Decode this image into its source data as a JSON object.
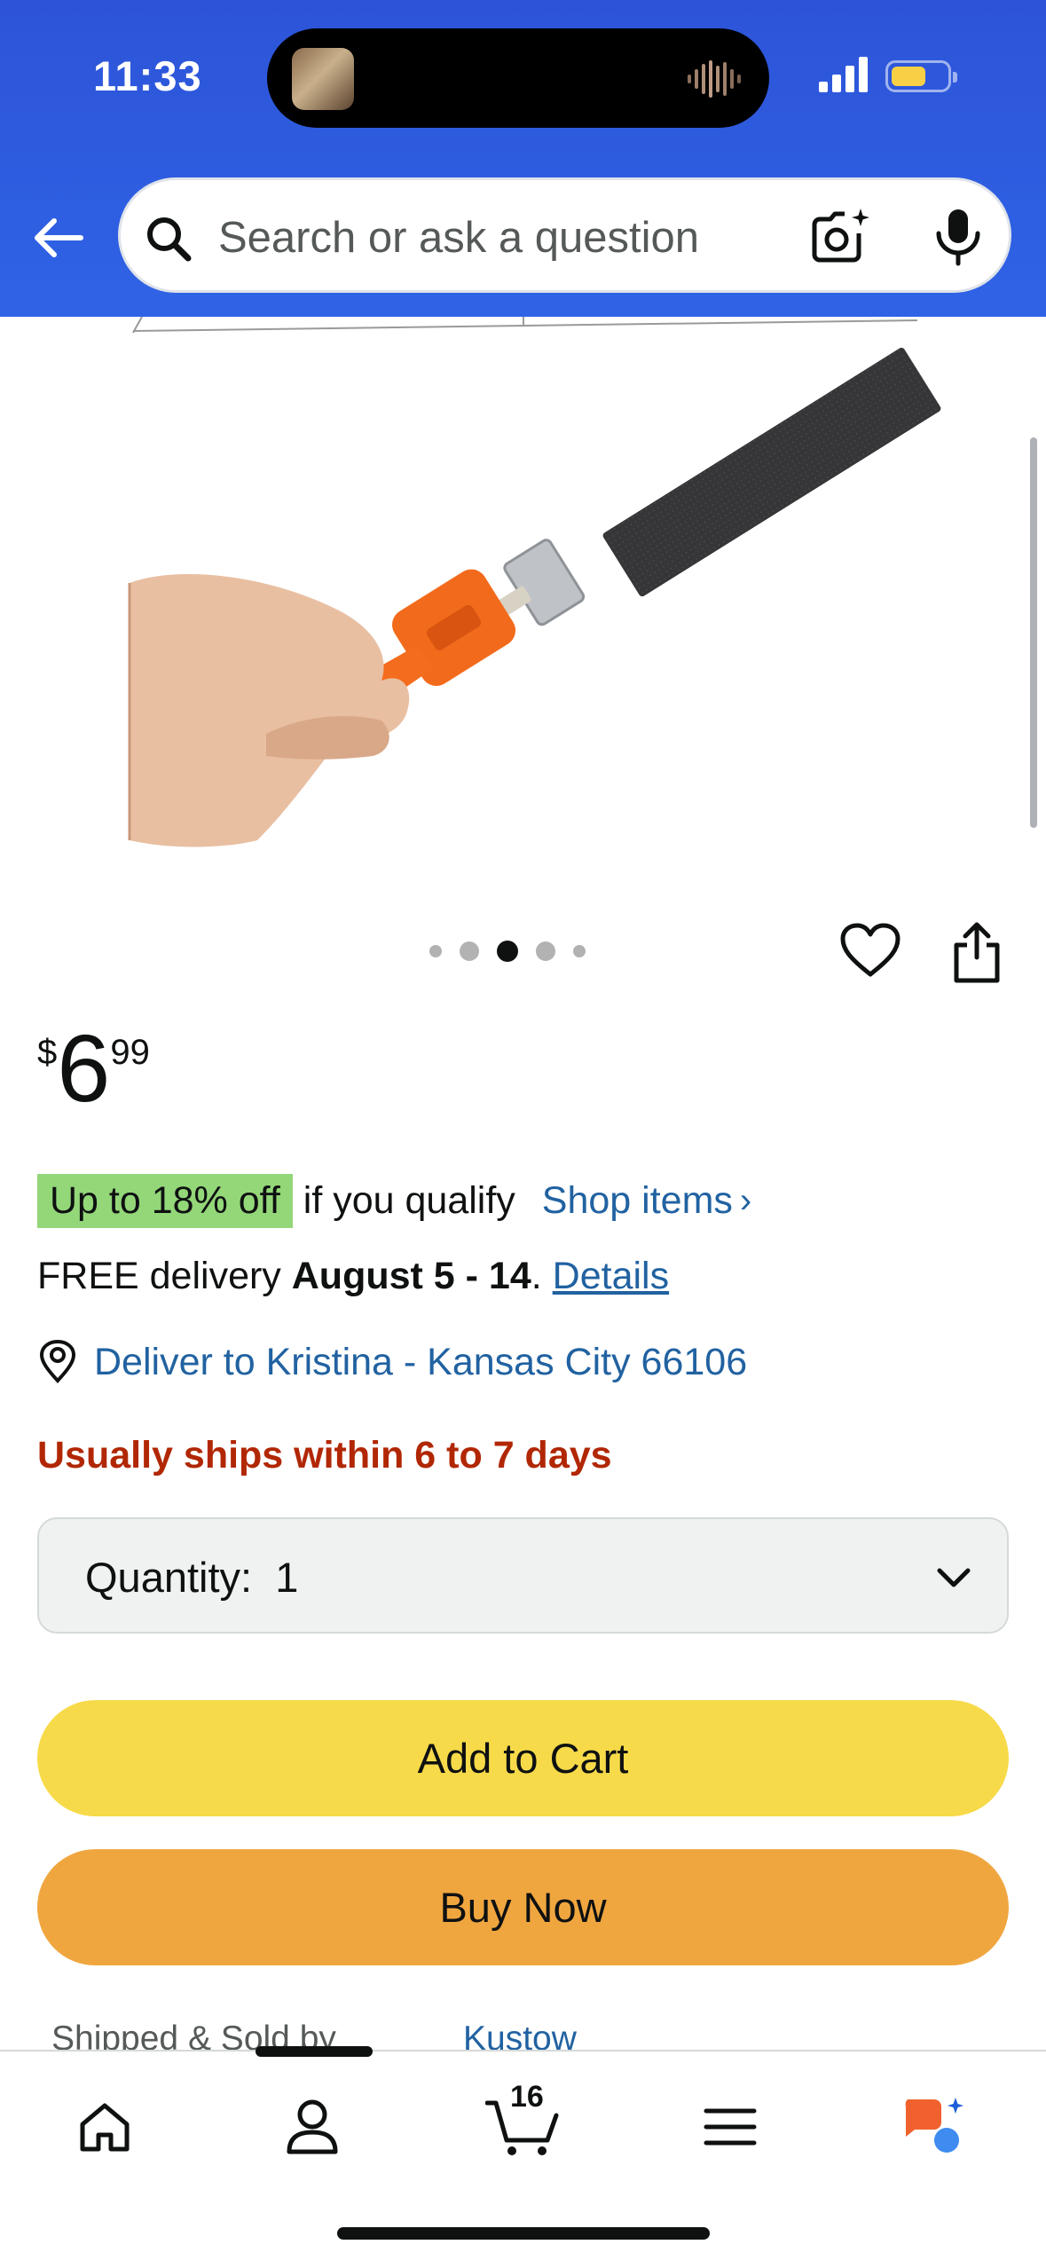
{
  "status_bar": {
    "time": "11:33"
  },
  "search": {
    "placeholder": "Search or ask a question"
  },
  "product": {
    "image_alt": "Orange-handled sharpening file held in hand",
    "carousel": {
      "count": 5,
      "active_index": 2
    }
  },
  "price": {
    "currency": "$",
    "whole": "6",
    "fraction": "99"
  },
  "promo": {
    "badge": "Up to 18% off",
    "qualifier": "if you qualify",
    "shop_link": "Shop items",
    "chevron": "›"
  },
  "delivery": {
    "prefix": "FREE delivery",
    "dates": "August 5 - 14",
    "suffix": ".",
    "details_link": "Details"
  },
  "deliver_to": {
    "text": "Deliver to Kristina - Kansas City 66106"
  },
  "shipping_note": "Usually ships within 6 to 7 days",
  "quantity": {
    "label": "Quantity:",
    "value": "1"
  },
  "buttons": {
    "add_to_cart": "Add to Cart",
    "buy_now": "Buy Now"
  },
  "seller": {
    "label": "Shipped & Sold by",
    "name": "Kustow"
  },
  "bottom_nav": {
    "cart_count": "16",
    "items": [
      "home-icon",
      "account-icon",
      "cart-icon",
      "menu-icon",
      "rufus-icon"
    ]
  },
  "colors": {
    "header_blue": "#2f5fe3",
    "promo_green": "#93d779",
    "link_blue": "#2162a1",
    "alert_red": "#b12704",
    "add_to_cart_yellow": "#f7da49",
    "buy_now_orange": "#f0a63f"
  }
}
